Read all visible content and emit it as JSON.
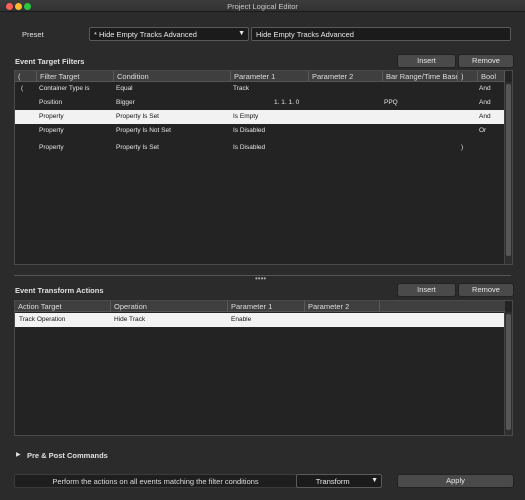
{
  "window": {
    "title": "Project Logical Editor"
  },
  "preset": {
    "label": "Preset",
    "selected": "* Hide Empty Tracks Advanced",
    "name": "Hide Empty Tracks Advanced"
  },
  "filters": {
    "heading": "Event Target Filters",
    "insert_label": "Insert",
    "remove_label": "Remove",
    "columns": [
      "(",
      "Filter Target",
      "Condition",
      "Parameter 1",
      "Parameter 2",
      "Bar Range/Time Base",
      ")",
      "Bool"
    ],
    "rows": [
      [
        "(",
        "Container Type is",
        "Equal",
        "Track",
        "",
        "",
        "",
        "And"
      ],
      [
        "",
        "Position",
        "Bigger",
        "1. 1. 1.  0",
        "",
        "PPQ",
        "",
        "And"
      ],
      [
        "",
        "Property",
        "Property Is Set",
        "Is Empty",
        "",
        "",
        "",
        "And"
      ],
      [
        "",
        "Property",
        "Property Is Not Set",
        "Is Disabled",
        "",
        "",
        "",
        "Or"
      ],
      [
        "",
        "Property",
        "Property Is Set",
        "Is Disabled",
        "",
        "",
        ")",
        ""
      ]
    ],
    "selected_row": 2
  },
  "actions": {
    "heading": "Event Transform Actions",
    "insert_label": "Insert",
    "remove_label": "Remove",
    "columns": [
      "Action Target",
      "Operation",
      "Parameter 1",
      "Parameter 2"
    ],
    "rows": [
      [
        "Track Operation",
        "Hide Track",
        "Enable",
        ""
      ]
    ],
    "selected_row": 0
  },
  "commands": {
    "label": "Pre & Post Commands"
  },
  "footer": {
    "description": "Perform the actions on all events matching the filter conditions",
    "function_selected": "Transform",
    "apply_label": "Apply"
  },
  "icons": {
    "disclosure": "triangle-right-icon",
    "dropdown": "chevron-down-icon",
    "grip": "splitter-grip-icon"
  }
}
